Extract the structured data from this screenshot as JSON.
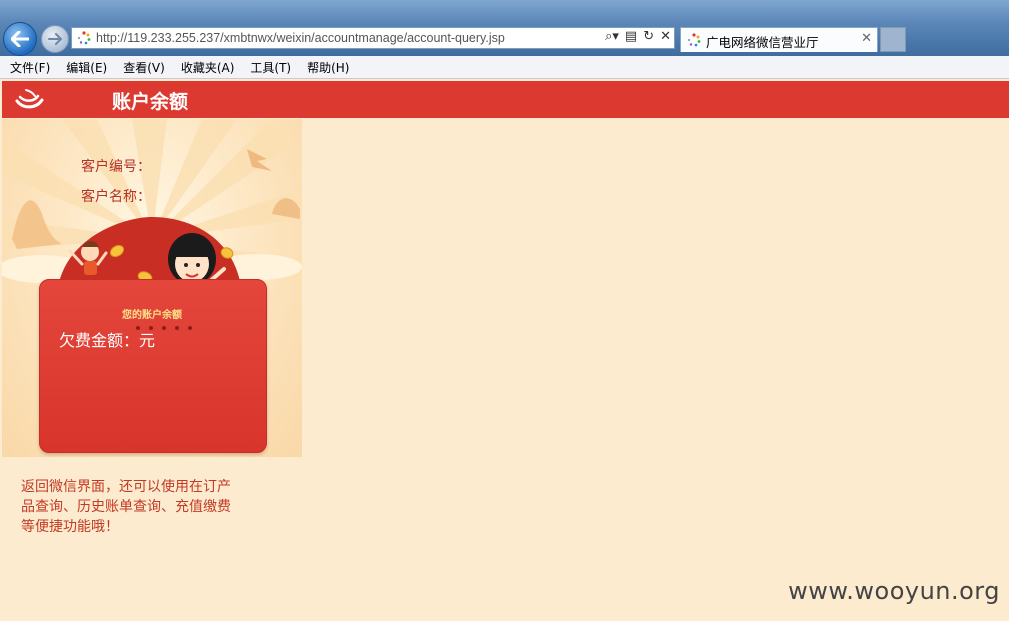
{
  "browser": {
    "address_url": "http://119.233.255.237/xmbtnwx/weixin/accountmanage/account-query.jsp",
    "tab_title": "广电网络微信营业厅",
    "menu": [
      "文件(F)",
      "编辑(E)",
      "查看(V)",
      "收藏夹(A)",
      "工具(T)",
      "帮助(H)"
    ]
  },
  "page": {
    "title": "账户余额",
    "customer_id_label": "客户编号：",
    "customer_name_label": "客户名称：",
    "card_banner": "您的账户余额",
    "arrears_label": "欠费金额：元",
    "hint": "返回微信界面，还可以使用在订产品查询、历史账单查询、充值缴费等便捷功能哦！"
  },
  "watermark": "www.wooyun.org",
  "colors": {
    "header_red": "#dc3a31",
    "page_bg": "#fdebd0",
    "card_red": "#e0433a",
    "hint_text": "#c33a23"
  }
}
